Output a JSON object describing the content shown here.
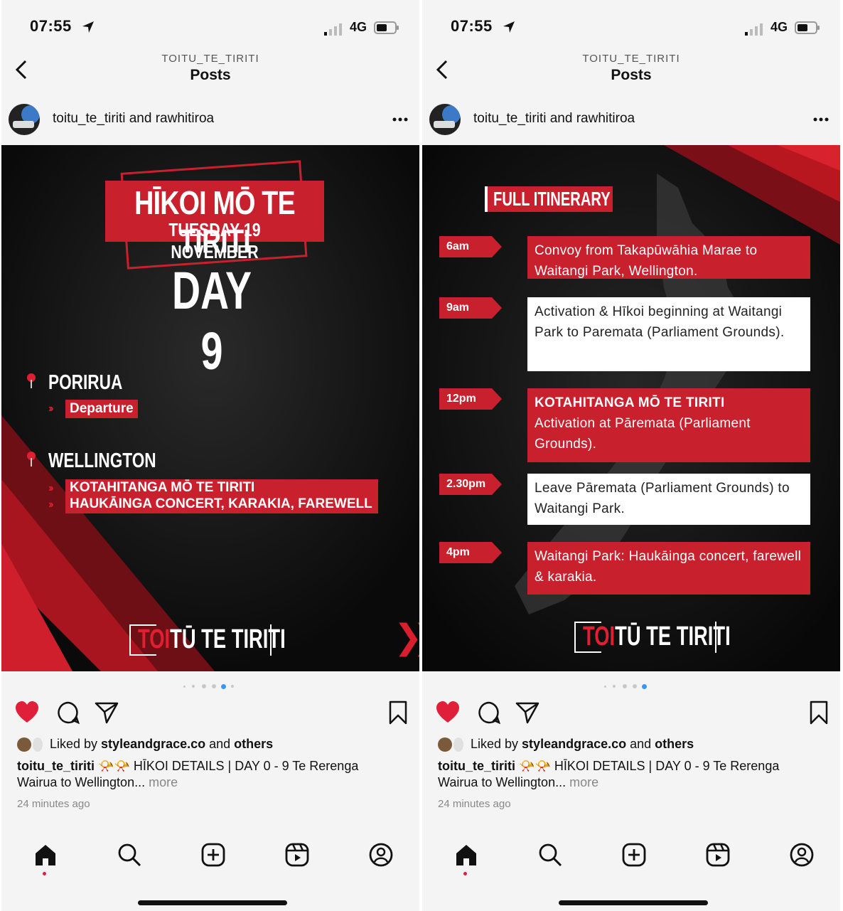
{
  "status": {
    "time": "07:55",
    "network": "4G"
  },
  "header": {
    "account": "TOITU_TE_TIRITI",
    "title": "Posts"
  },
  "post": {
    "user_main": "toitu_te_tiriti",
    "user_join": " and ",
    "user_collab": "rawhitiroa"
  },
  "slide_left": {
    "title": "HĪKOI MŌ TE TIRITI",
    "subtitle": "TUESDAY 19 NOVEMBER",
    "day": "DAY 9",
    "place1": "PORIRUA",
    "place1_tag": "Departure",
    "place2": "WELLINGTON",
    "place2_tag1": "KOTAHITANGA MŌ TE TIRITI",
    "place2_tag2": "HAUKĀINGA CONCERT, KARAKIA, FAREWELL",
    "brand_toi": "TOI",
    "brand_rest": "TŪ TE TIRITI",
    "next_arrows": "❯❯❯"
  },
  "slide_right": {
    "heading": "FULL ITINERARY",
    "items": [
      {
        "time": "6am",
        "text": "Convoy from Takapūwāhia Marae to Waitangi Park, Wellington."
      },
      {
        "time": "9am",
        "text": "Activation & Hīkoi beginning at Waitangi Park to Paremata (Parliament Grounds)."
      },
      {
        "time": "12pm",
        "bold": "KOTAHITANGA MŌ TE TIRITI",
        "text": "Activation at Pāremata (Parliament Grounds)."
      },
      {
        "time": "2.30pm",
        "text": "Leave Pāremata (Parliament Grounds) to Waitangi Park."
      },
      {
        "time": "4pm",
        "text": "Waitangi Park: Haukāinga concert, farewell & karakia."
      }
    ],
    "brand_toi": "TOI",
    "brand_rest": "TŪ TE TIRITI"
  },
  "engagement": {
    "liked_prefix": "Liked by ",
    "liked_user": "styleandgrace.co",
    "liked_mid": " and ",
    "liked_others": "others",
    "caption_user": "toitu_te_tiriti",
    "caption_emoji": "📯📯",
    "caption_text": " HĪKOI DETAILS | DAY 0 - 9 Te Rerenga Wairua to Wellington...",
    "more": " more",
    "time_ago": "24 minutes ago"
  },
  "colors": {
    "accent_red": "#c8202d",
    "like_red": "#e0203a",
    "dot_blue": "#3897f0"
  },
  "icons": [
    "back-icon",
    "more-icon",
    "heart-icon",
    "comment-icon",
    "share-icon",
    "bookmark-icon",
    "home-icon",
    "search-icon",
    "create-icon",
    "reels-icon",
    "profile-icon"
  ]
}
